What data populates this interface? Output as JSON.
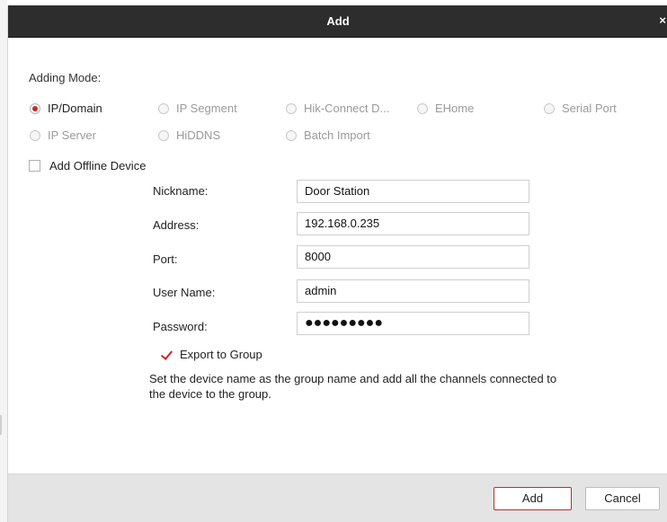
{
  "dialog": {
    "title": "Add",
    "close_symbol": "×",
    "close_icon": "close-icon"
  },
  "adding_mode": {
    "label": "Adding Mode:",
    "options": [
      {
        "label": "IP/Domain",
        "selected": true
      },
      {
        "label": "IP Segment",
        "selected": false
      },
      {
        "label": "Hik-Connect D...",
        "selected": false
      },
      {
        "label": "EHome",
        "selected": false
      },
      {
        "label": "Serial Port",
        "selected": false
      },
      {
        "label": "IP Server",
        "selected": false
      },
      {
        "label": "HiDDNS",
        "selected": false
      },
      {
        "label": "Batch Import",
        "selected": false
      }
    ]
  },
  "offline": {
    "label": "Add Offline Device",
    "checked": false
  },
  "form": {
    "nickname": {
      "label": "Nickname:",
      "value": "Door Station"
    },
    "address": {
      "label": "Address:",
      "value": "192.168.0.235"
    },
    "port": {
      "label": "Port:",
      "value": "8000"
    },
    "username": {
      "label": "User Name:",
      "value": "admin"
    },
    "password": {
      "label": "Password:",
      "value": "●●●●●●●●●"
    }
  },
  "export_group": {
    "label": "Export to Group",
    "checked": true,
    "note": "Set the device name as the group name and add all the channels connected to the device to the group."
  },
  "buttons": {
    "add": "Add",
    "cancel": "Cancel"
  },
  "colors": {
    "accent": "#c8282e",
    "titlebar": "#2d2d2d",
    "footer": "#e4e4e4"
  }
}
